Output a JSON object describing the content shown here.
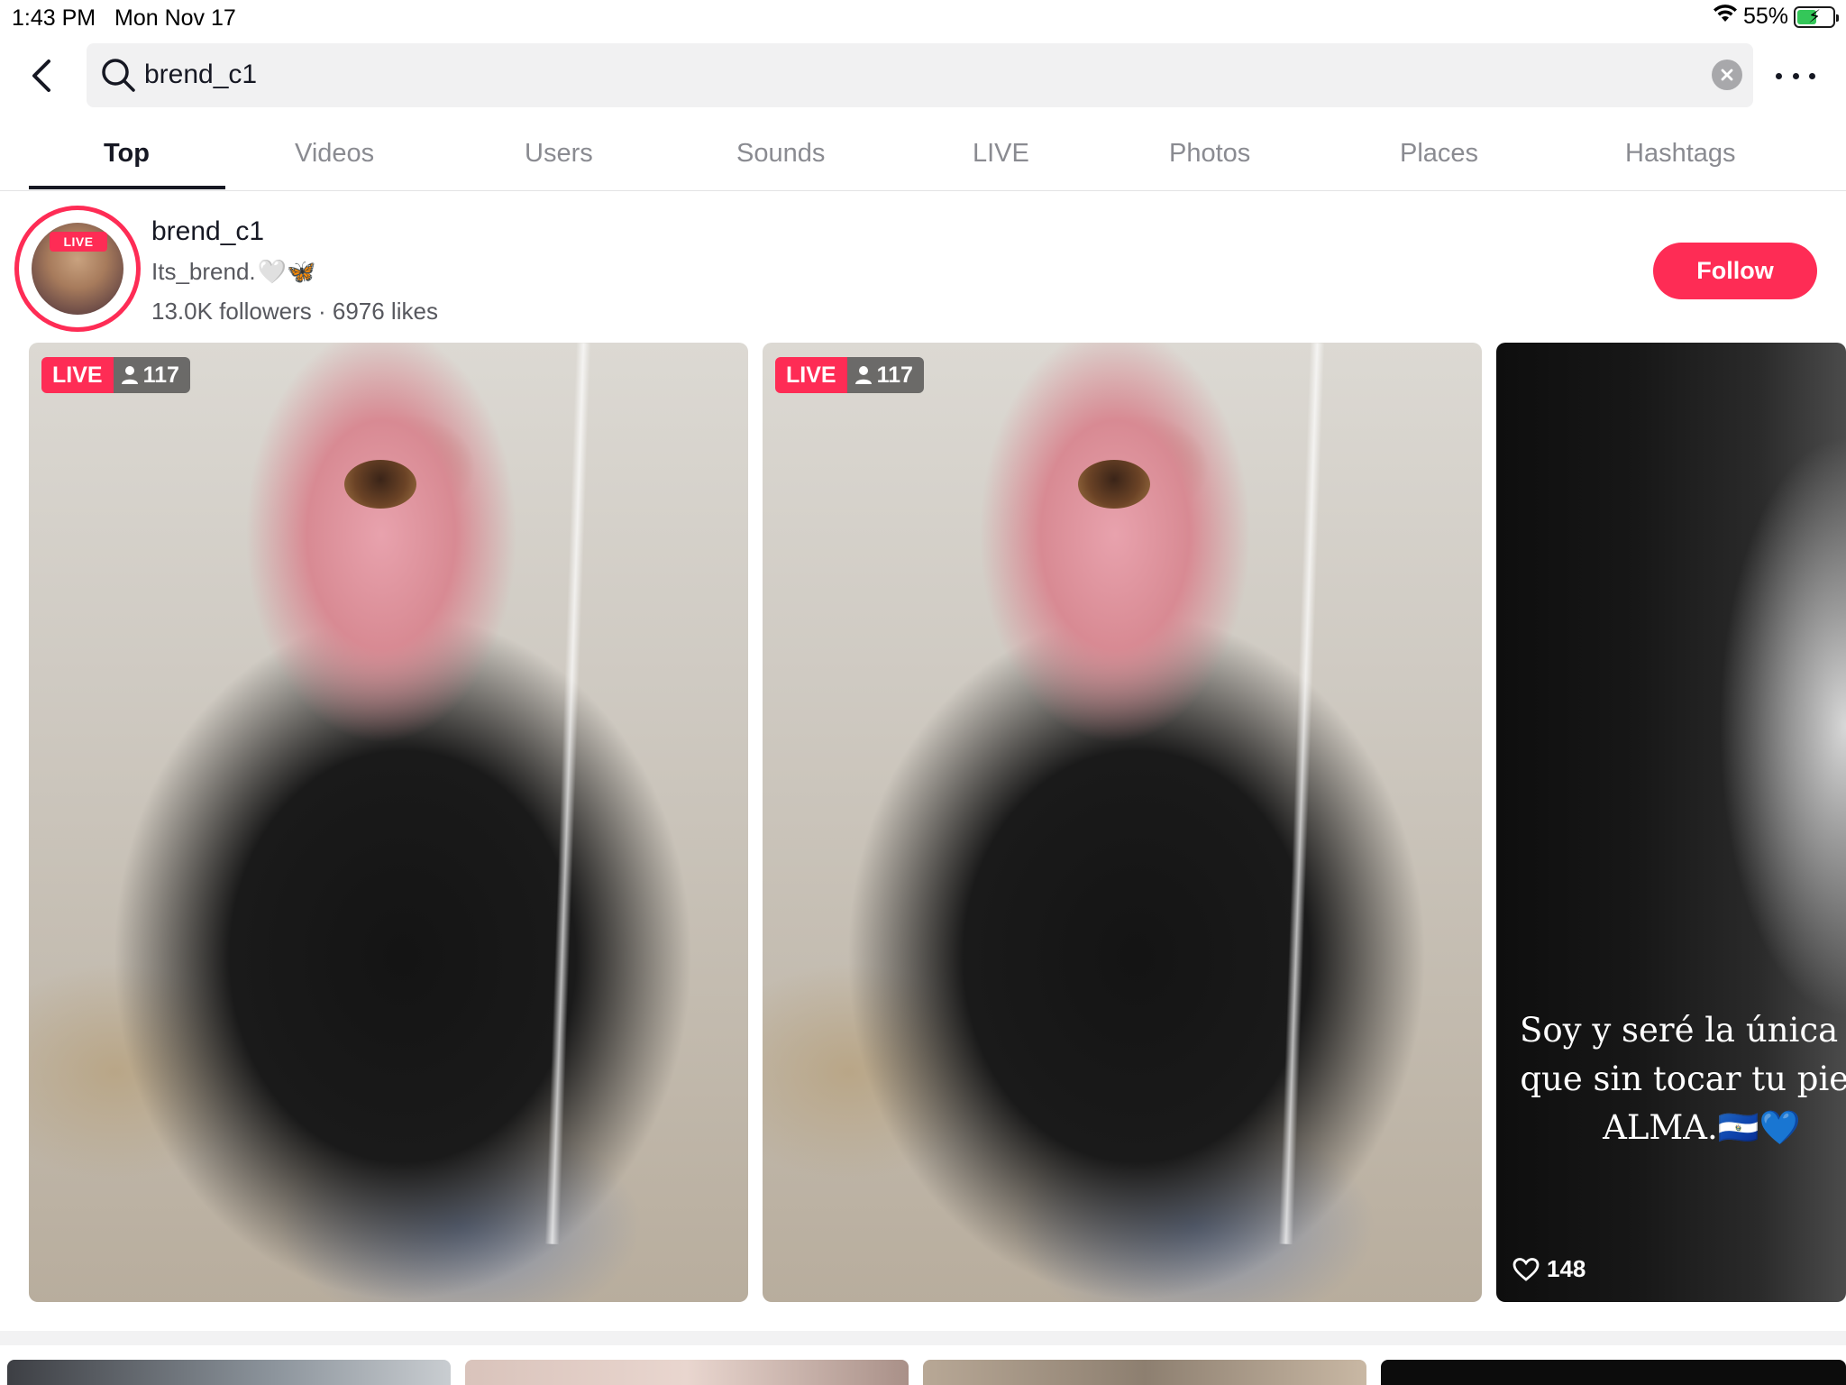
{
  "status_bar": {
    "time": "1:43 PM",
    "date": "Mon Nov 17",
    "battery": "55%"
  },
  "search": {
    "query": "brend_c1"
  },
  "tabs": [
    {
      "label": "Top",
      "active": true
    },
    {
      "label": "Videos",
      "active": false
    },
    {
      "label": "Users",
      "active": false
    },
    {
      "label": "Sounds",
      "active": false
    },
    {
      "label": "LIVE",
      "active": false
    },
    {
      "label": "Photos",
      "active": false
    },
    {
      "label": "Places",
      "active": false
    },
    {
      "label": "Hashtags",
      "active": false
    }
  ],
  "user": {
    "avatar_badge": "LIVE",
    "username": "brend_c1",
    "bio": "Its_brend.",
    "bio_emoji": "🤍🦋",
    "stats": "13.0K followers · 6976 likes",
    "follow_label": "Follow"
  },
  "cards": [
    {
      "type": "live",
      "badge": "LIVE",
      "viewers": "117"
    },
    {
      "type": "live",
      "badge": "LIVE",
      "viewers": "117"
    },
    {
      "type": "photo",
      "caption_lines": [
        "Soy y seré la única Bi",
        "que sin tocar tu piel t",
        "ALMA.🇸🇻💙"
      ],
      "likes": "148"
    }
  ],
  "colors": {
    "accent": "#fe2c55",
    "text_primary": "#161823",
    "text_secondary": "#8a8b91",
    "search_bg": "#f1f1f2"
  },
  "icons": [
    "back-arrow-icon",
    "search-icon",
    "clear-icon",
    "more-icon",
    "person-icon",
    "heart-icon",
    "wifi-icon",
    "battery-icon"
  ]
}
